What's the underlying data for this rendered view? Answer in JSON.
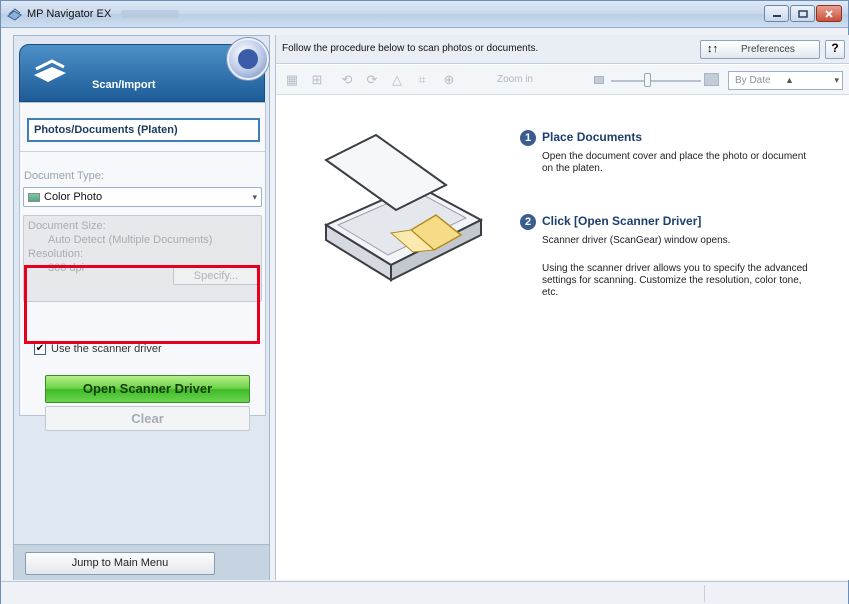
{
  "window": {
    "title": "MP Navigator EX"
  },
  "left": {
    "tab_label": "Scan/Import",
    "source_button": "Photos/Documents (Platen)",
    "document_type_label": "Document Type:",
    "document_type_value": "Color Photo",
    "document_size_label": "Document Size:",
    "document_size_value": "Auto Detect (Multiple Documents)",
    "resolution_label": "Resolution:",
    "resolution_value": "300 dpi",
    "specify_button": "Specify...",
    "use_scanner_driver_label": "Use the scanner driver",
    "use_scanner_driver_checked": true,
    "open_driver_button": "Open Scanner Driver",
    "clear_button": "Clear",
    "jump_button": "Jump to Main Menu"
  },
  "right": {
    "instruction": "Follow the procedure below to scan photos or documents.",
    "preferences_button": "Preferences",
    "help_button": "?",
    "zoom_label": "Zoom in",
    "sort_value": "By Date",
    "steps": [
      {
        "num": "1",
        "title": "Place Documents",
        "text": "Open the document cover and place the photo or document on the platen."
      },
      {
        "num": "2",
        "title": "Click [Open Scanner Driver]",
        "text1": "Scanner driver (ScanGear) window opens.",
        "text2": "Using the scanner driver allows you to specify the advanced settings for scanning. Customize the resolution, color tone, etc."
      }
    ]
  },
  "colors": {
    "highlight_red": "#e6001e",
    "driver_green": "#4cc431",
    "tab_blue": "#2c6aa6"
  }
}
